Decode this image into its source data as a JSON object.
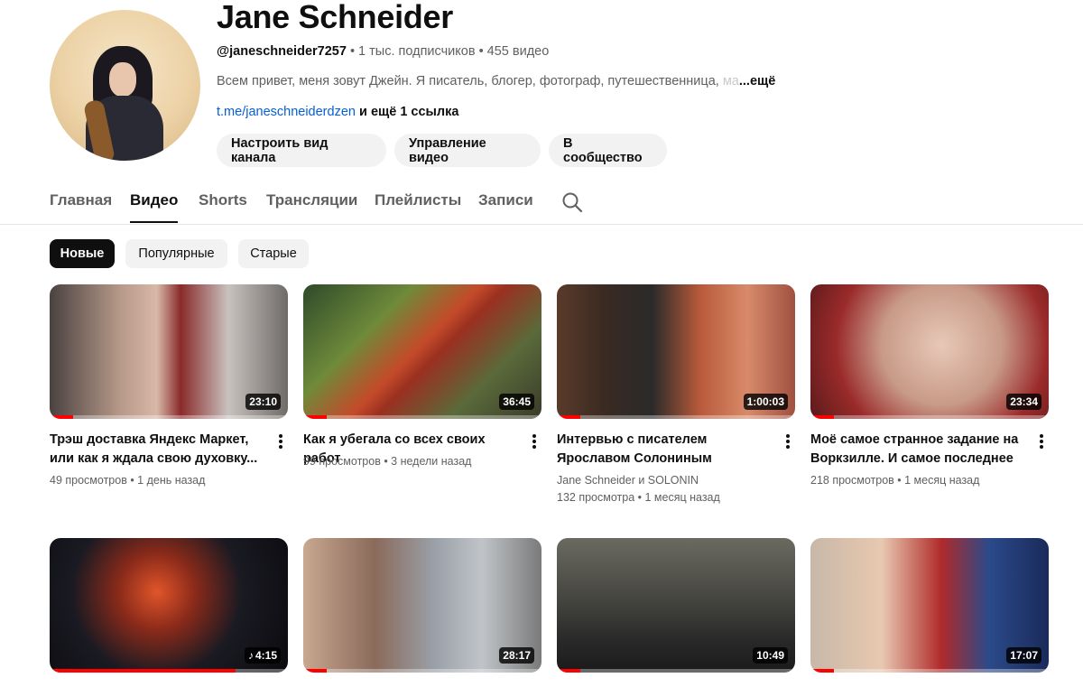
{
  "channel": {
    "name": "Jane Schneider",
    "handle": "@janeschneider7257",
    "subscribers": " • 1 тыс. подписчиков",
    "videos_count": " • 455 видео",
    "description": "Всем привет, меня зовут Джейн. Я писатель, блогер, фотограф, путешественница,",
    "description_fade": " ма",
    "description_more": "...ещё",
    "link": "t.me/janeschneiderdzen",
    "link_extra": " и ещё 1 ссылка"
  },
  "actions": {
    "customize": "Настроить вид канала",
    "manage": "Управление видео",
    "community": "В сообщество"
  },
  "tabs": [
    "Главная",
    "Видео",
    "Shorts",
    "Трансляции",
    "Плейлисты",
    "Записи"
  ],
  "active_tab": "Видео",
  "chips": [
    "Новые",
    "Популярные",
    "Старые"
  ],
  "videos": [
    {
      "title": "Трэш доставка Яндекс Маркет, или как я ждала свою духовку...",
      "views": "49 просмотров",
      "age": " • 1 день назад",
      "duration": "23:10",
      "progress": 0.1
    },
    {
      "title": "Как я убегала со всех своих работ",
      "views": "99 просмотров",
      "age": " • 3 недели назад",
      "duration": "36:45",
      "progress": 0.1
    },
    {
      "title": "Интервью с писателем Ярославом Солониным",
      "authors": "Jane Schneider и SOLONIN",
      "views": "132 просмотра",
      "age": " • 1 месяц назад",
      "duration": "1:00:03",
      "progress": 0.1
    },
    {
      "title": "Моё самое странное задание на Воркзилле. И самое последнее",
      "views": "218 просмотров",
      "age": " • 1 месяц назад",
      "duration": "23:34",
      "progress": 0.1
    },
    {
      "duration": "4:15",
      "progress": 0.78,
      "music": true
    },
    {
      "duration": "28:17",
      "progress": 0.1
    },
    {
      "duration": "10:49",
      "progress": 0.1
    },
    {
      "duration": "17:07",
      "progress": 0.1
    }
  ],
  "colors": {
    "accent": "#ff0000",
    "link": "#065fd4",
    "chip_bg": "#f2f2f2"
  },
  "icons": {
    "search": "search-icon",
    "more": "kebab-menu-icon",
    "music": "music-note-icon"
  }
}
